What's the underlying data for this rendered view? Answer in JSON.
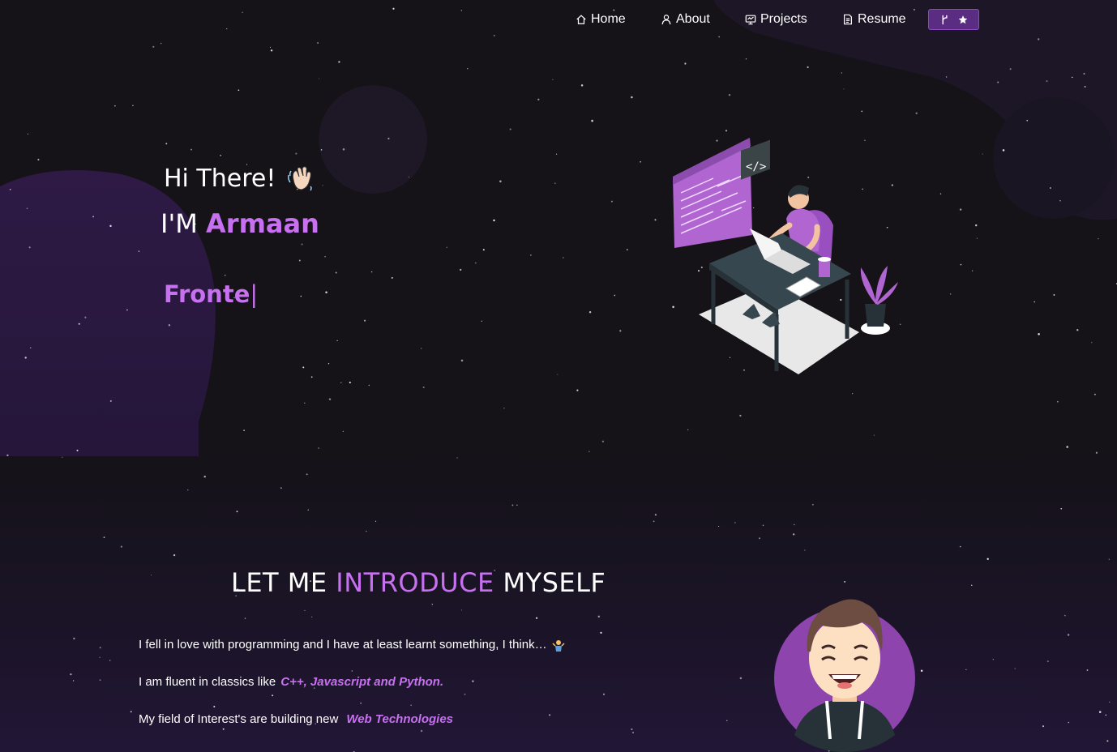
{
  "navbar": {
    "items": [
      {
        "label": "Home",
        "icon": "home-icon"
      },
      {
        "label": "About",
        "icon": "user-icon"
      },
      {
        "label": "Projects",
        "icon": "projects-icon"
      },
      {
        "label": "Resume",
        "icon": "document-icon"
      }
    ],
    "fork_button": {
      "icons": [
        "git-fork-icon",
        "star-icon"
      ]
    }
  },
  "hero": {
    "greeting": "Hi There!",
    "greeting_icon": "waving-hand-icon",
    "name_prefix": "I'M",
    "name": "Armaan",
    "typewriter_text": "Fronte",
    "typewriter_cursor": "|",
    "illustration": "developer-at-desk-illustration"
  },
  "intro": {
    "heading_part1": "LET ME",
    "heading_highlight": "INTRODUCE",
    "heading_part2": "MYSELF",
    "paragraph1": "I fell in love with programming and I have at least learnt something, I think…",
    "paragraph1_icon": "person-shrugging-icon",
    "paragraph2_text": "I am fluent in classics like",
    "paragraph2_highlight": "C++, Javascript and Python.",
    "paragraph3_text": "My field of Interest's are building new",
    "paragraph3_highlight": "Web Technologies",
    "avatar": "avatar-illustration"
  },
  "colors": {
    "accent": "#c770f0",
    "background": "#141217",
    "button": "#5a2d82"
  }
}
